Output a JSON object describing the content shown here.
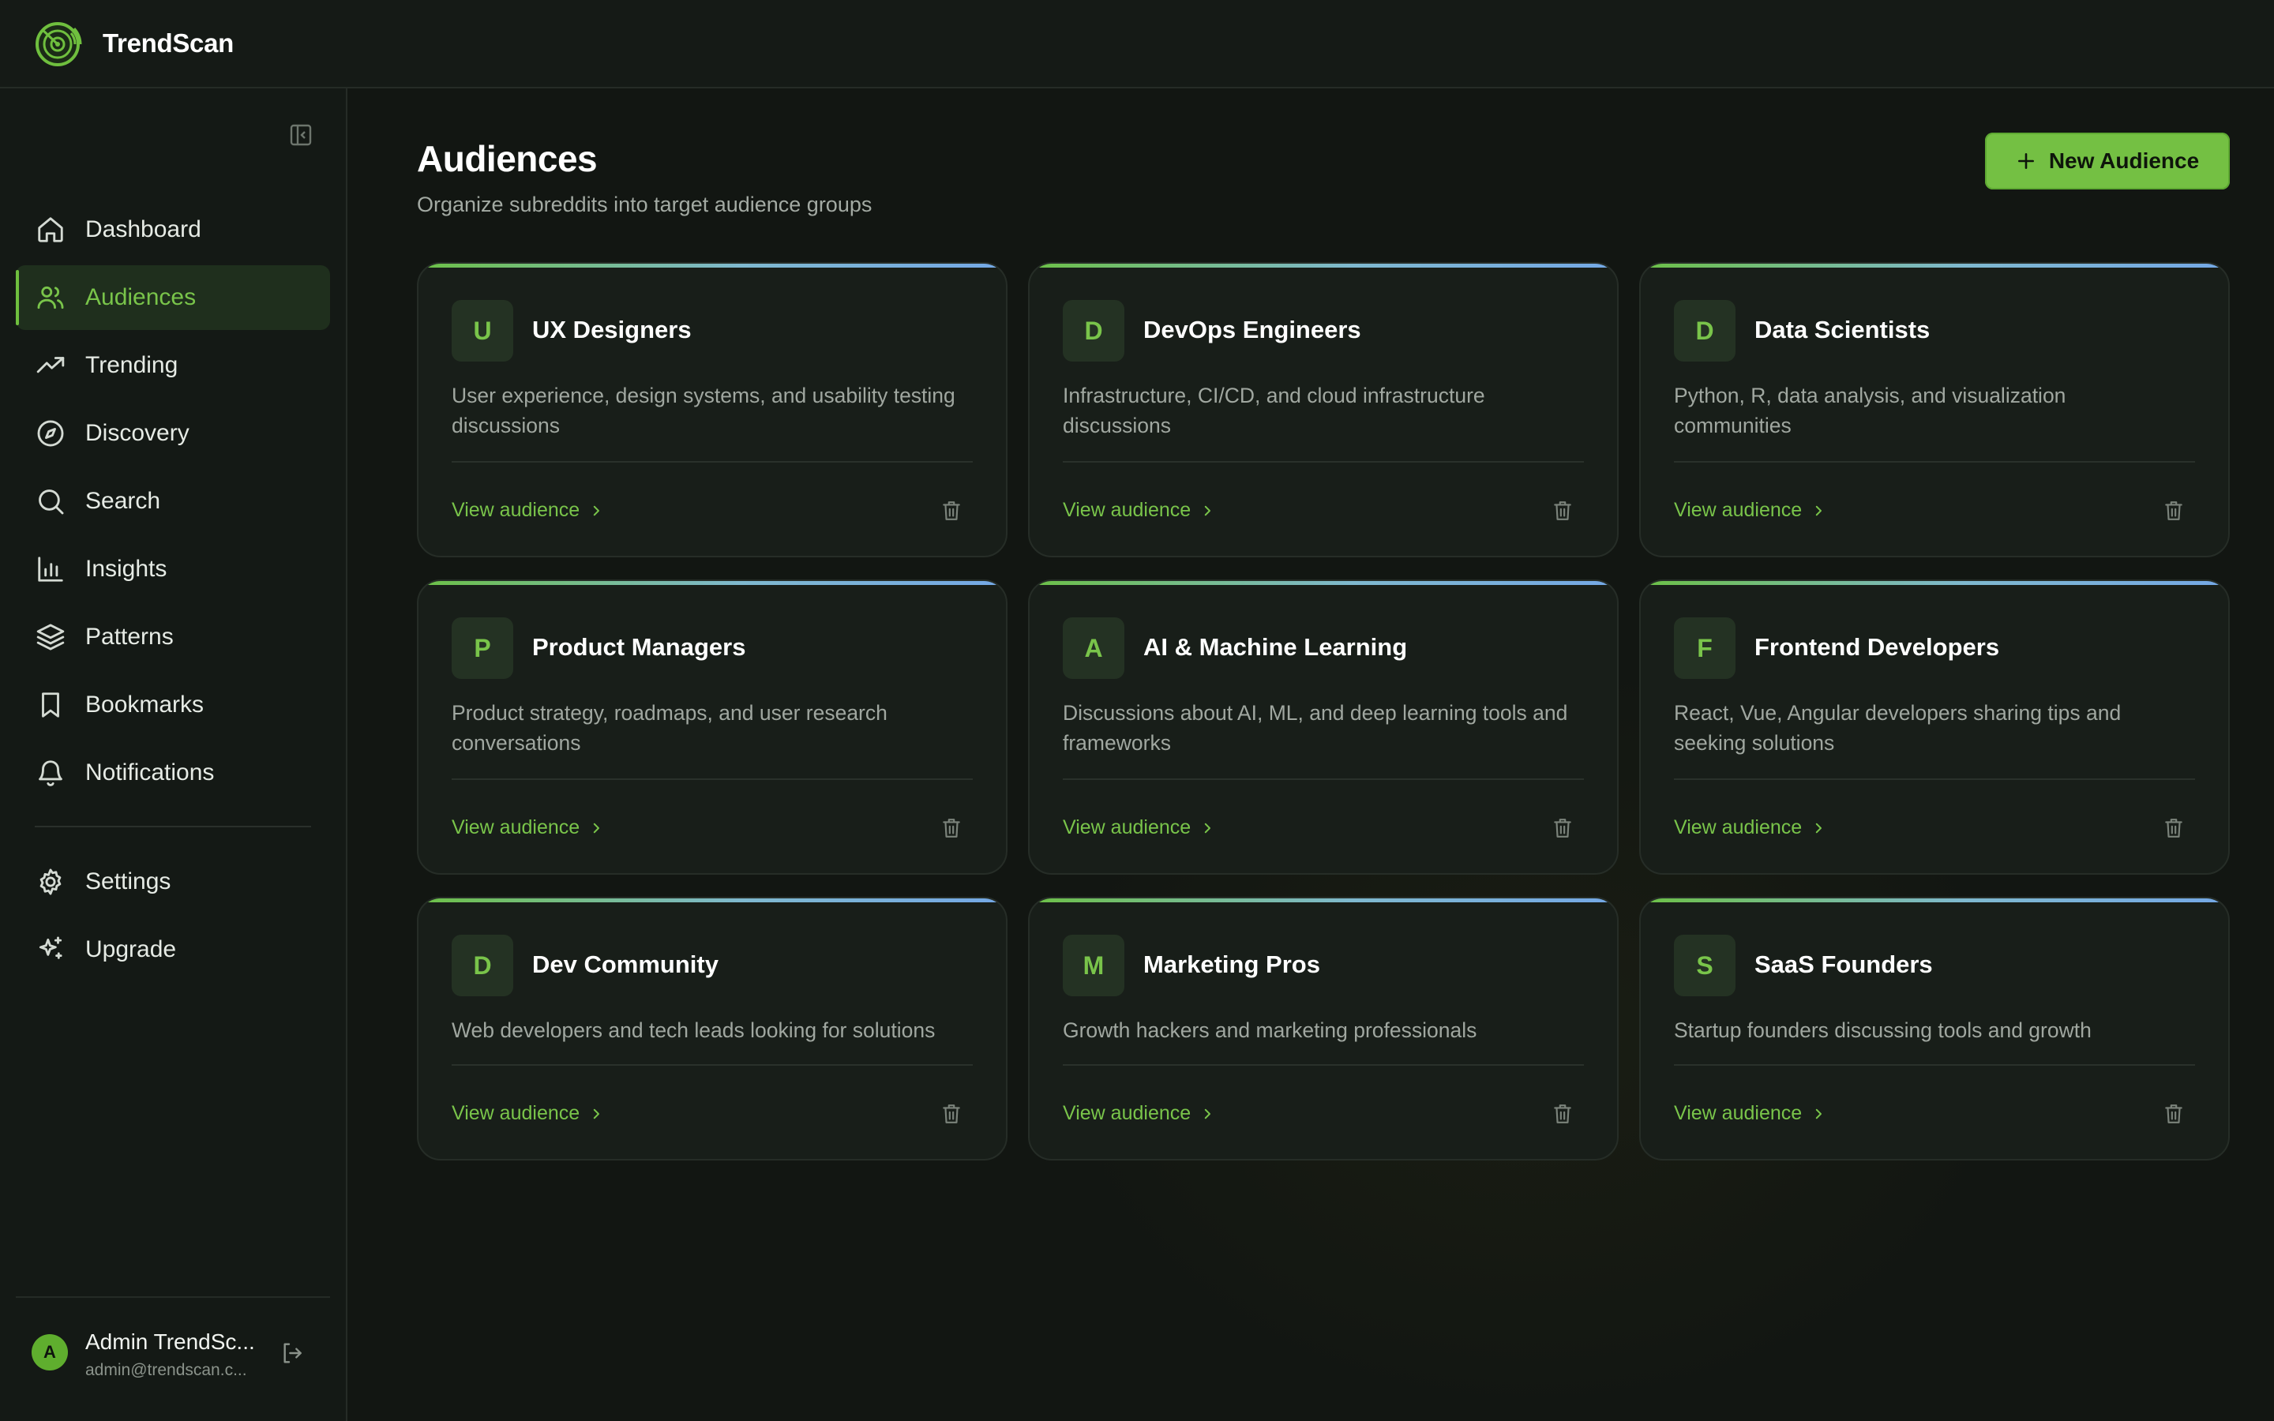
{
  "app": {
    "name": "TrendScan"
  },
  "sidebar": {
    "items": [
      {
        "label": "Dashboard",
        "icon": "home-icon",
        "active": false
      },
      {
        "label": "Audiences",
        "icon": "users-icon",
        "active": true
      },
      {
        "label": "Trending",
        "icon": "trending-up-icon",
        "active": false
      },
      {
        "label": "Discovery",
        "icon": "compass-icon",
        "active": false
      },
      {
        "label": "Search",
        "icon": "search-icon",
        "active": false
      },
      {
        "label": "Insights",
        "icon": "bar-chart-icon",
        "active": false
      },
      {
        "label": "Patterns",
        "icon": "layers-icon",
        "active": false
      },
      {
        "label": "Bookmarks",
        "icon": "bookmark-icon",
        "active": false
      },
      {
        "label": "Notifications",
        "icon": "bell-icon",
        "active": false
      }
    ],
    "secondary": [
      {
        "label": "Settings",
        "icon": "gear-icon"
      },
      {
        "label": "Upgrade",
        "icon": "sparkles-icon"
      }
    ],
    "user": {
      "initial": "A",
      "name": "Admin TrendSc...",
      "email": "admin@trendscan.c..."
    }
  },
  "page": {
    "title": "Audiences",
    "subtitle": "Organize subreddits into target audience groups",
    "new_button": "New Audience"
  },
  "audiences": [
    {
      "initial": "U",
      "name": "UX Designers",
      "description": "User experience, design systems, and usability testing discussions",
      "link": "View audience"
    },
    {
      "initial": "D",
      "name": "DevOps Engineers",
      "description": "Infrastructure, CI/CD, and cloud infrastructure discussions",
      "link": "View audience"
    },
    {
      "initial": "D",
      "name": "Data Scientists",
      "description": "Python, R, data analysis, and visualization communities",
      "link": "View audience"
    },
    {
      "initial": "P",
      "name": "Product Managers",
      "description": "Product strategy, roadmaps, and user research conversations",
      "link": "View audience"
    },
    {
      "initial": "A",
      "name": "AI & Machine Learning",
      "description": "Discussions about AI, ML, and deep learning tools and frameworks",
      "link": "View audience"
    },
    {
      "initial": "F",
      "name": "Frontend Developers",
      "description": "React, Vue, Angular developers sharing tips and seeking solutions",
      "link": "View audience"
    },
    {
      "initial": "D",
      "name": "Dev Community",
      "description": "Web developers and tech leads looking for solutions",
      "link": "View audience"
    },
    {
      "initial": "M",
      "name": "Marketing Pros",
      "description": "Growth hackers and marketing professionals",
      "link": "View audience"
    },
    {
      "initial": "S",
      "name": "SaaS Founders",
      "description": "Startup founders discussing tools and growth",
      "link": "View audience"
    }
  ],
  "colors": {
    "accent": "#74c043",
    "accent_text": "#79c44a",
    "background": "#121612",
    "card": "#181e19",
    "gradient_start": "#6cc046",
    "gradient_end": "#74a8e6"
  }
}
